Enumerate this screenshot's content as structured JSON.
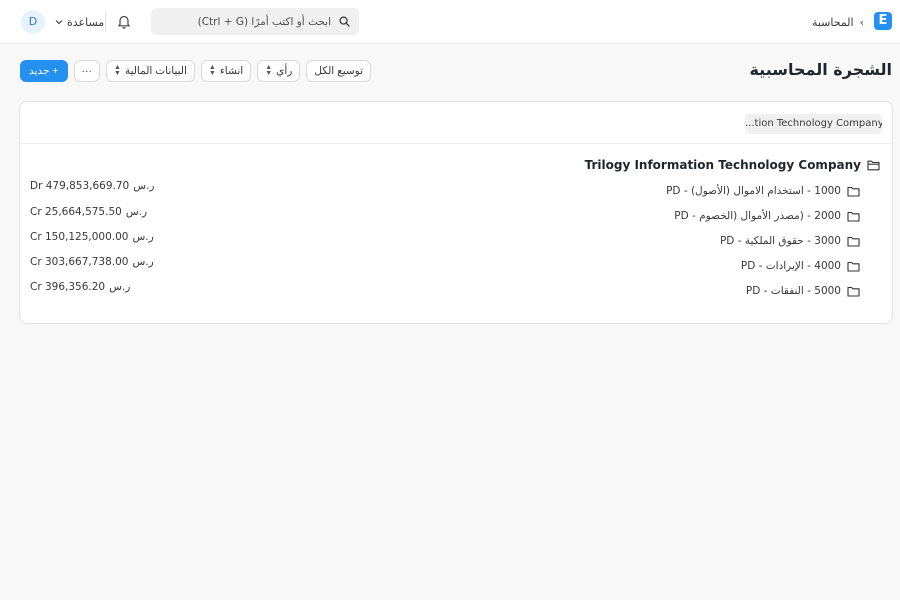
{
  "navbar": {
    "logo_letter": "E",
    "breadcrumb": "المحاسبة",
    "breadcrumb_sep": "›",
    "search_placeholder": "ابحث أو اكتب أمرًا (Ctrl + G)",
    "help_label": "مساعدة",
    "avatar_letter": "D"
  },
  "page": {
    "title": "الشجرة المحاسبية"
  },
  "toolbar": {
    "expand_all": "توسيع الكل",
    "view": "رأي",
    "create": "انشاء",
    "financial_statements": "البيانات المالية",
    "more": "···",
    "new": "+ جديد"
  },
  "filter": {
    "company": "...tion Technology Company"
  },
  "tree": {
    "root": "Trilogy Information Technology Company",
    "nodes": [
      {
        "label": "1000 - استخدام الاموال (الأصول) - PD",
        "currency": "ر.س",
        "amount": "Dr 479,853,669.70"
      },
      {
        "label": "2000 - (مصدر الأموال (الخصوم - PD",
        "currency": "ر.س",
        "amount": "Cr 25,664,575.50"
      },
      {
        "label": "3000 - حقوق الملكية - PD",
        "currency": "ر.س",
        "amount": "Cr 150,125,000.00"
      },
      {
        "label": "4000 - الإيرادات - PD",
        "currency": "ر.س",
        "amount": "Cr 303,667,738.00"
      },
      {
        "label": "5000 - النفقات - PD",
        "currency": "ر.س",
        "amount": "Cr 396,356.20"
      }
    ]
  }
}
